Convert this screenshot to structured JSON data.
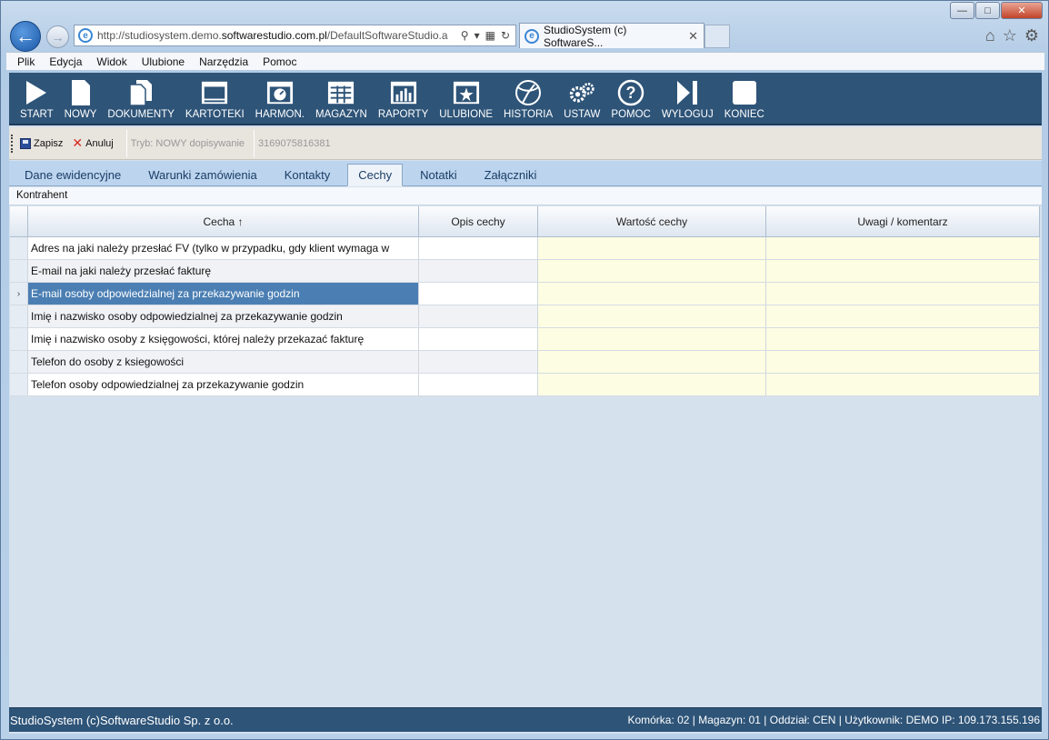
{
  "browser": {
    "address_prefix": "http://studiosystem.demo.",
    "address_domain": "softwarestudio.com.pl",
    "address_suffix": "/DefaultSoftwareStudio.a",
    "tab_title": "StudioSystem (c) SoftwareS...",
    "tab_close": "✕"
  },
  "menu": {
    "file": "Plik",
    "edit": "Edycja",
    "view": "Widok",
    "favorites": "Ulubione",
    "tools": "Narzędzia",
    "help": "Pomoc"
  },
  "toolbar": [
    {
      "label": "START",
      "icon": "play-icon"
    },
    {
      "label": "NOWY",
      "icon": "new-document-icon"
    },
    {
      "label": "DOKUMENTY",
      "icon": "documents-icon"
    },
    {
      "label": "KARTOTEKI",
      "icon": "cards-icon"
    },
    {
      "label": "HARMON.",
      "icon": "schedule-icon"
    },
    {
      "label": "MAGAZYN",
      "icon": "warehouse-icon"
    },
    {
      "label": "RAPORTY",
      "icon": "reports-icon"
    },
    {
      "label": "ULUBIONE",
      "icon": "favorites-icon"
    },
    {
      "label": "HISTORIA",
      "icon": "history-icon"
    },
    {
      "label": "USTAW",
      "icon": "settings-icon"
    },
    {
      "label": "POMOC",
      "icon": "help-icon"
    },
    {
      "label": "WYLOGUJ",
      "icon": "logout-icon"
    },
    {
      "label": "KONIEC",
      "icon": "exit-icon"
    }
  ],
  "actions": {
    "save": "Zapisz",
    "cancel": "Anuluj",
    "mode": "Tryb: NOWY dopisywanie",
    "record_id": "3169075816381"
  },
  "tabs": [
    "Dane ewidencyjne",
    "Warunki zamówienia",
    "Kontakty",
    "Cechy",
    "Notatki",
    "Załączniki"
  ],
  "active_tab": "Cechy",
  "section_title": "Kontrahent",
  "grid": {
    "columns": [
      "Cecha ↑",
      "Opis cechy",
      "Wartość cechy",
      "Uwagi / komentarz"
    ],
    "rows": [
      "Adres na jaki należy przesłać FV (tylko w przypadku, gdy klient wymaga w",
      "E-mail na jaki należy przesłać fakturę",
      "E-mail osoby odpowiedzialnej za przekazywanie godzin",
      "Imię i nazwisko osoby odpowiedzialnej za przekazywanie godzin",
      "Imię i nazwisko osoby z księgowości, której należy przekazać fakturę",
      "Telefon do osoby z ksiegowości",
      "Telefon osoby odpowiedzialnej za przekazywanie godzin"
    ],
    "selected_row": 2,
    "row_pointer": "›"
  },
  "status": {
    "left": "StudioSystem (c)SoftwareStudio Sp. z o.o.",
    "right": "Komórka: 02 | Magazyn: 01 | Oddział: CEN | Użytkownik: DEMO IP: 109.173.155.196"
  }
}
